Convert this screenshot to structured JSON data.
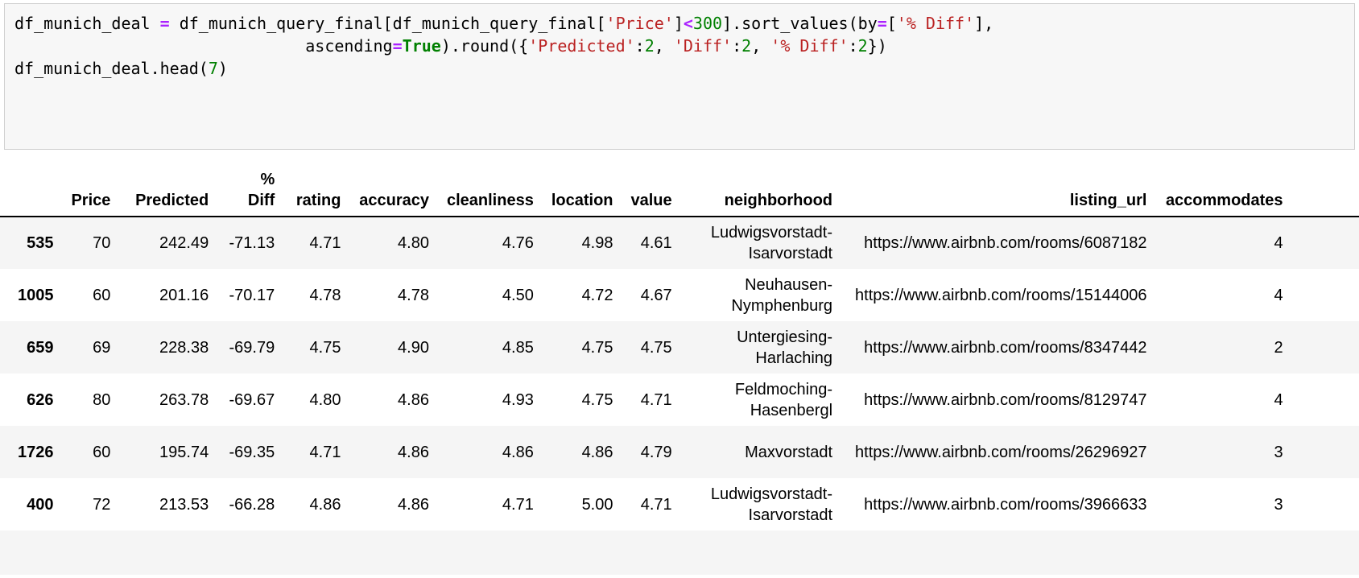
{
  "code_cell": {
    "language": "python",
    "lines": [
      [
        {
          "t": "df_munich_deal ",
          "k": "plain"
        },
        {
          "t": "=",
          "k": "op"
        },
        {
          "t": " df_munich_query_final[df_munich_query_final[",
          "k": "plain"
        },
        {
          "t": "'Price'",
          "k": "str"
        },
        {
          "t": "]",
          "k": "plain"
        },
        {
          "t": "<",
          "k": "op"
        },
        {
          "t": "300",
          "k": "num"
        },
        {
          "t": "].sort_values(by",
          "k": "plain"
        },
        {
          "t": "=",
          "k": "op"
        },
        {
          "t": "[",
          "k": "plain"
        },
        {
          "t": "'% Diff'",
          "k": "str"
        },
        {
          "t": "],",
          "k": "plain"
        }
      ],
      [
        {
          "t": "                              ascending",
          "k": "plain"
        },
        {
          "t": "=",
          "k": "op"
        },
        {
          "t": "True",
          "k": "kw"
        },
        {
          "t": ").round({",
          "k": "plain"
        },
        {
          "t": "'Predicted'",
          "k": "str"
        },
        {
          "t": ":",
          "k": "plain"
        },
        {
          "t": "2",
          "k": "num"
        },
        {
          "t": ", ",
          "k": "plain"
        },
        {
          "t": "'Diff'",
          "k": "str"
        },
        {
          "t": ":",
          "k": "plain"
        },
        {
          "t": "2",
          "k": "num"
        },
        {
          "t": ", ",
          "k": "plain"
        },
        {
          "t": "'% Diff'",
          "k": "str"
        },
        {
          "t": ":",
          "k": "plain"
        },
        {
          "t": "2",
          "k": "num"
        },
        {
          "t": "})",
          "k": "plain"
        }
      ],
      [
        {
          "t": "df_munich_deal.head(",
          "k": "plain"
        },
        {
          "t": "7",
          "k": "num"
        },
        {
          "t": ")",
          "k": "plain"
        }
      ]
    ]
  },
  "dataframe": {
    "index_header": "",
    "columns": [
      "Price",
      "Predicted",
      "% Diff",
      "rating",
      "accuracy",
      "cleanliness",
      "location",
      "value",
      "neighborhood",
      "listing_url",
      "accommodates"
    ],
    "column_pct_diff_line1": "%",
    "column_pct_diff_line2": "Diff",
    "rows": [
      {
        "index": "535",
        "Price": "70",
        "Predicted": "242.49",
        "pct_diff": "-71.13",
        "rating": "4.71",
        "accuracy": "4.80",
        "cleanliness": "4.76",
        "location": "4.98",
        "value": "4.61",
        "neighborhood": "Ludwigsvorstadt-Isarvorstadt",
        "listing_url": "https://www.airbnb.com/rooms/6087182",
        "accommodates": "4"
      },
      {
        "index": "1005",
        "Price": "60",
        "Predicted": "201.16",
        "pct_diff": "-70.17",
        "rating": "4.78",
        "accuracy": "4.78",
        "cleanliness": "4.50",
        "location": "4.72",
        "value": "4.67",
        "neighborhood": "Neuhausen-Nymphenburg",
        "listing_url": "https://www.airbnb.com/rooms/15144006",
        "accommodates": "4"
      },
      {
        "index": "659",
        "Price": "69",
        "Predicted": "228.38",
        "pct_diff": "-69.79",
        "rating": "4.75",
        "accuracy": "4.90",
        "cleanliness": "4.85",
        "location": "4.75",
        "value": "4.75",
        "neighborhood": "Untergiesing-Harlaching",
        "listing_url": "https://www.airbnb.com/rooms/8347442",
        "accommodates": "2"
      },
      {
        "index": "626",
        "Price": "80",
        "Predicted": "263.78",
        "pct_diff": "-69.67",
        "rating": "4.80",
        "accuracy": "4.86",
        "cleanliness": "4.93",
        "location": "4.75",
        "value": "4.71",
        "neighborhood": "Feldmoching-Hasenbergl",
        "listing_url": "https://www.airbnb.com/rooms/8129747",
        "accommodates": "4"
      },
      {
        "index": "1726",
        "Price": "60",
        "Predicted": "195.74",
        "pct_diff": "-69.35",
        "rating": "4.71",
        "accuracy": "4.86",
        "cleanliness": "4.86",
        "location": "4.86",
        "value": "4.79",
        "neighborhood": "Maxvorstadt",
        "listing_url": "https://www.airbnb.com/rooms/26296927",
        "accommodates": "3"
      },
      {
        "index": "400",
        "Price": "72",
        "Predicted": "213.53",
        "pct_diff": "-66.28",
        "rating": "4.86",
        "accuracy": "4.86",
        "cleanliness": "4.71",
        "location": "5.00",
        "value": "4.71",
        "neighborhood": "Ludwigsvorstadt-Isarvorstadt",
        "listing_url": "https://www.airbnb.com/rooms/3966633",
        "accommodates": "3"
      },
      {
        "index": "",
        "Price": "",
        "Predicted": "",
        "pct_diff": "",
        "rating": "",
        "accuracy": "",
        "cleanliness": "",
        "location": "",
        "value": "",
        "neighborhood": "",
        "listing_url": "",
        "accommodates": ""
      }
    ]
  },
  "colors": {
    "code_background": "#f7f7f7",
    "code_border": "#cfcfcf",
    "string_token": "#ba2121",
    "number_token": "#008000",
    "keyword_token": "#008000",
    "operator_token": "#aa22ff",
    "row_stripe": "#f5f5f5",
    "text": "#000000"
  }
}
